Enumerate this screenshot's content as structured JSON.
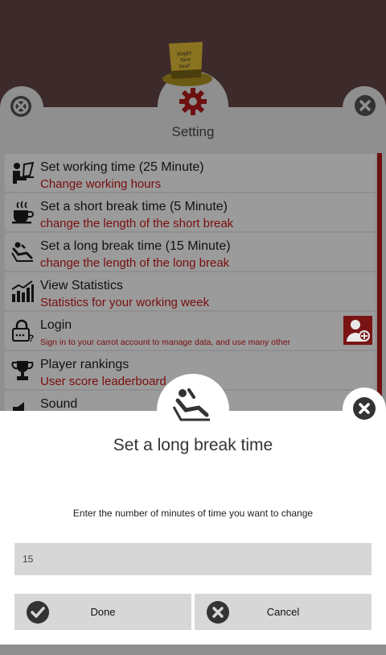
{
  "settings": {
    "title": "Setting",
    "items": [
      {
        "title": "Set working time (25 Minute)",
        "subtitle": "Change working hours",
        "icon": "worker-laptop-icon"
      },
      {
        "title": "Set a short break time (5 Minute)",
        "subtitle": "change the length of the short break",
        "icon": "coffee-cup-icon"
      },
      {
        "title": "Set a long break time (15 Minute)",
        "subtitle": "change the length of the long break",
        "icon": "relax-chair-icon"
      },
      {
        "title": "View Statistics",
        "subtitle": "Statistics for your working week",
        "icon": "statistics-chart-icon"
      },
      {
        "title": "Login",
        "subtitle": "Sign in to your carrot account to manage data, and use many other",
        "icon": "lock-icon"
      },
      {
        "title": "Player rankings",
        "subtitle": "User score leaderboard",
        "icon": "trophy-icon"
      },
      {
        "title": "Sound",
        "subtitle": "",
        "icon": "speaker-icon"
      }
    ]
  },
  "hat_text": "Happy New Year!",
  "dialog": {
    "title": "Set a long break time",
    "message": "Enter the number of minutes of time you want to change",
    "input_value": "15",
    "done_label": "Done",
    "cancel_label": "Cancel"
  },
  "colors": {
    "background": "#3d2a2b",
    "panel": "#8f8f8f",
    "accent": "#7a0d0d",
    "dialog": "#ffffff"
  }
}
